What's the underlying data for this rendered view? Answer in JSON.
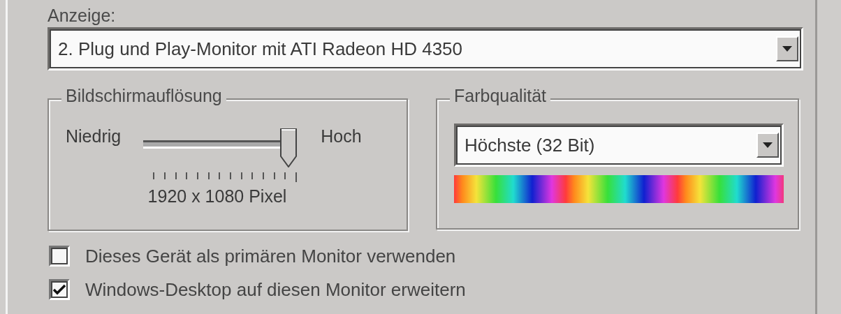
{
  "display": {
    "label": "Anzeige:",
    "value": "2. Plug und Play-Monitor mit ATI Radeon HD 4350"
  },
  "resolution": {
    "title": "Bildschirmauflösung",
    "low_label": "Niedrig",
    "high_label": "Hoch",
    "level": 1,
    "reading": "1920 x 1080 Pixel"
  },
  "color_quality": {
    "title": "Farbqualität",
    "value": "Höchste (32 Bit)"
  },
  "options": [
    {
      "label": "Dieses Gerät als primären Monitor verwenden",
      "checked": false
    },
    {
      "label": "Windows-Desktop auf diesen Monitor erweitern",
      "checked": true
    }
  ]
}
